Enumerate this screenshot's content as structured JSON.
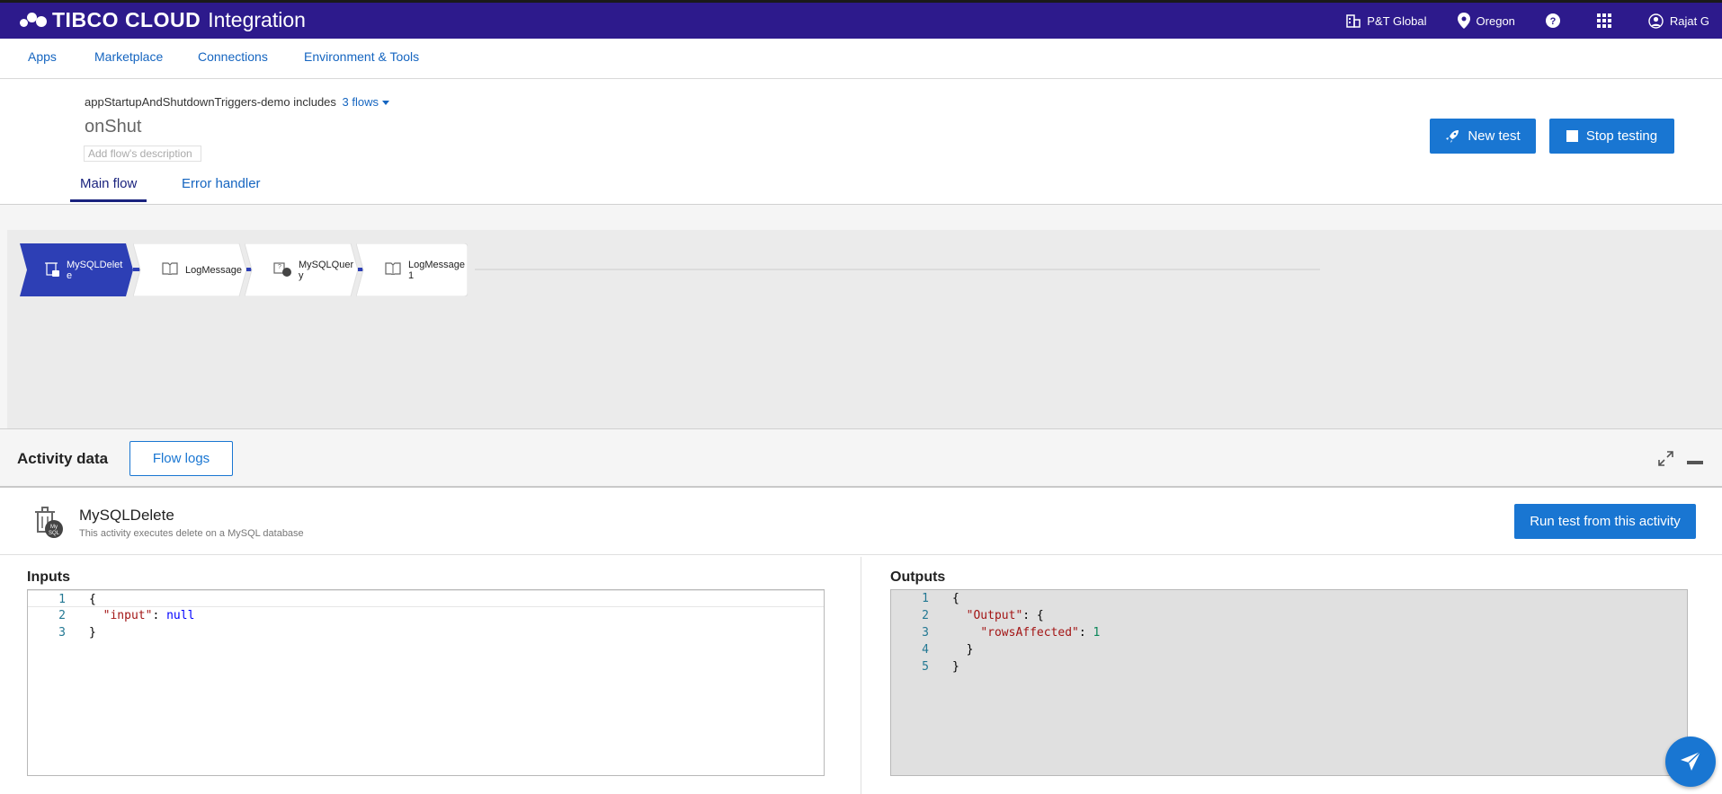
{
  "app": {
    "brand_main": "TIBCO CLOUD",
    "brand_sub": "Integration",
    "org": "P&T Global",
    "region": "Oregon",
    "user": "Rajat G"
  },
  "nav": {
    "items": [
      "Apps",
      "Marketplace",
      "Connections",
      "Environment & Tools"
    ]
  },
  "flow": {
    "app_name": "appStartupAndShutdownTriggers-demo includes",
    "flows_link": "3 flows",
    "name": "onShut",
    "description_placeholder": "Add flow's description",
    "tabs": [
      "Main flow",
      "Error handler"
    ],
    "new_test_label": "New test",
    "stop_testing_label": "Stop testing"
  },
  "canvas": {
    "activities": [
      {
        "label": "MySQLDelete",
        "icon": "mysql-delete-icon",
        "selected": true
      },
      {
        "label": "LogMessage",
        "icon": "log-message-icon",
        "selected": false
      },
      {
        "label": "MySQLQuery",
        "icon": "mysql-query-icon",
        "selected": false
      },
      {
        "label": "LogMessage1",
        "icon": "log-message-icon",
        "selected": false
      }
    ]
  },
  "activity_data": {
    "title": "Activity data",
    "flow_logs_label": "Flow logs",
    "activity_name": "MySQLDelete",
    "activity_desc": "This activity executes delete on a MySQL database",
    "run_test_label": "Run test from this activity",
    "inputs_title": "Inputs",
    "outputs_title": "Outputs",
    "inputs_lines": [
      {
        "n": "1",
        "text": "{"
      },
      {
        "n": "2",
        "key": "\"input\"",
        "sep": ": ",
        "val": "null",
        "indent": "  "
      },
      {
        "n": "3",
        "text": "}"
      }
    ],
    "outputs_lines": [
      {
        "n": "1",
        "text": "{"
      },
      {
        "n": "2",
        "key": "\"Output\"",
        "sep": ": {",
        "val": "",
        "indent": "  "
      },
      {
        "n": "3",
        "key": "\"rowsAffected\"",
        "sep": ": ",
        "val": "1",
        "indent": "    "
      },
      {
        "n": "4",
        "text": "  }"
      },
      {
        "n": "5",
        "text": "}"
      }
    ]
  },
  "colors": {
    "topbar": "#2d1a8c",
    "primary": "#1976d2",
    "selected_activity": "#2d3fb5"
  }
}
